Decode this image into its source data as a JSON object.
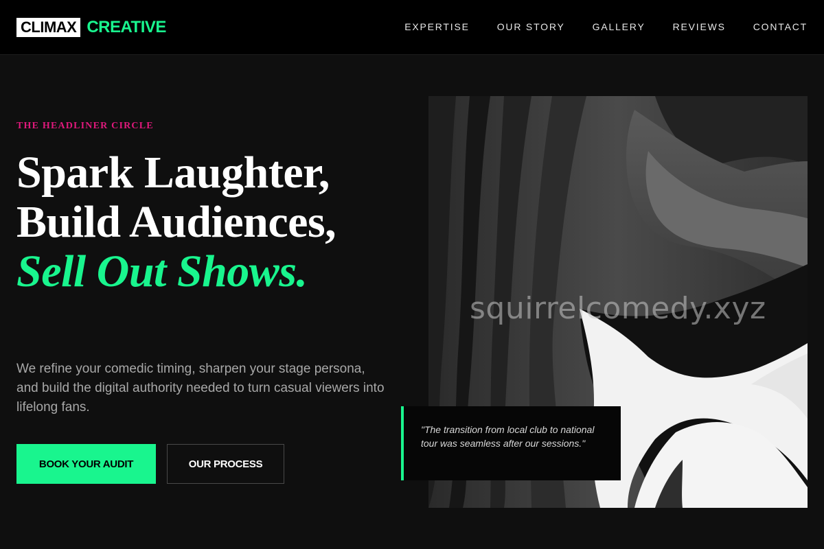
{
  "brand": {
    "logo_box": "CLIMAX",
    "logo_accent": "CREATIVE"
  },
  "nav": {
    "items": [
      {
        "label": "EXPERTISE"
      },
      {
        "label": "OUR STORY"
      },
      {
        "label": "GALLERY"
      },
      {
        "label": "REVIEWS"
      },
      {
        "label": "CONTACT"
      }
    ]
  },
  "hero": {
    "eyebrow": "THE HEADLINER CIRCLE",
    "headline_plain": "Spark Laughter, Build Audiences, ",
    "headline_accent": "Sell Out Shows.",
    "lede": "We refine your comedic timing, sharpen your stage persona, and build the digital authority needed to turn casual viewers into lifelong fans.",
    "primary_cta": "BOOK YOUR AUDIT",
    "secondary_cta": "OUR PROCESS"
  },
  "media": {
    "watermark": "squirrelcomedy.xyz",
    "quote": "\"The transition from local club to national tour was seamless after our sessions.\""
  },
  "colors": {
    "accent_green": "#19f58e",
    "accent_pink": "#e0197c",
    "background": "#0f0f0f",
    "topbar": "#000000"
  }
}
